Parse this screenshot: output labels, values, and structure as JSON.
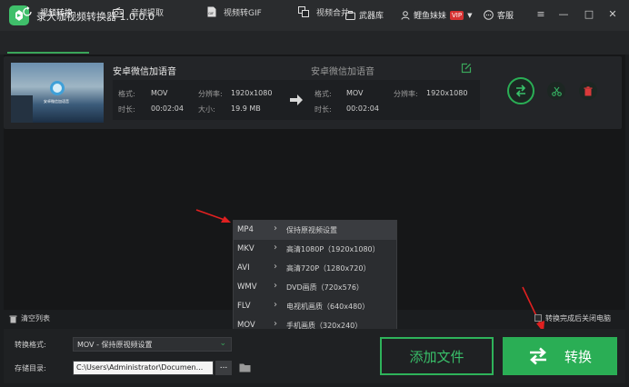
{
  "app": {
    "title": "录大咖视频转换器 1.0.0.0",
    "arsenal_label": "武器库",
    "user_name": "鲤鱼妹妹",
    "vip_badge": "VIP",
    "service_label": "客服"
  },
  "tabs": [
    {
      "label": "视频转换",
      "icon": "refresh-icon",
      "active": true
    },
    {
      "label": "音频提取",
      "icon": "radio-icon",
      "active": false
    },
    {
      "label": "视频转GIF",
      "icon": "gif-file-icon",
      "active": false
    },
    {
      "label": "视频合并",
      "icon": "merge-icon",
      "active": false
    }
  ],
  "file": {
    "name": "安卓微信加语音",
    "output_name": "安卓微信加语音",
    "thumb_caption": "安卓微信加语音",
    "source": {
      "format_label": "格式:",
      "format": "MOV",
      "resolution_label": "分辨率:",
      "resolution": "1920x1080",
      "duration_label": "时长:",
      "duration": "00:02:04",
      "size_label": "大小:",
      "size": "19.9 MB"
    },
    "target": {
      "format_label": "格式:",
      "format": "MOV",
      "resolution_label": "分辨率:",
      "resolution": "1920x1080",
      "duration_label": "时长:",
      "duration": "00:02:04"
    }
  },
  "format_menu": {
    "formats": [
      "MP4",
      "MKV",
      "AVI",
      "WMV",
      "FLV",
      "MOV"
    ],
    "options": [
      "保持原视频设置",
      "高清1080P（1920x1080）",
      "高清720P（1280x720）",
      "DVD画质（720x576）",
      "电视机画质（640x480）",
      "手机画质（320x240）"
    ],
    "selected_format": "MP4"
  },
  "bottom": {
    "clear_list": "清空列表",
    "shutdown_after": "转换完成后关闭电脑",
    "format_label": "转换格式:",
    "format_value": "MOV - 保持原视频设置",
    "dir_label": "存储目录:",
    "dir_value": "C:\\Users\\Administrator\\Documen...",
    "browse_label": "...",
    "add_file": "添加文件",
    "convert": "转换"
  },
  "colors": {
    "accent": "#2aae55",
    "titlebar": "#2a2c2e",
    "background": "#1b1d1f",
    "annotation_arrow": "#e02020"
  }
}
